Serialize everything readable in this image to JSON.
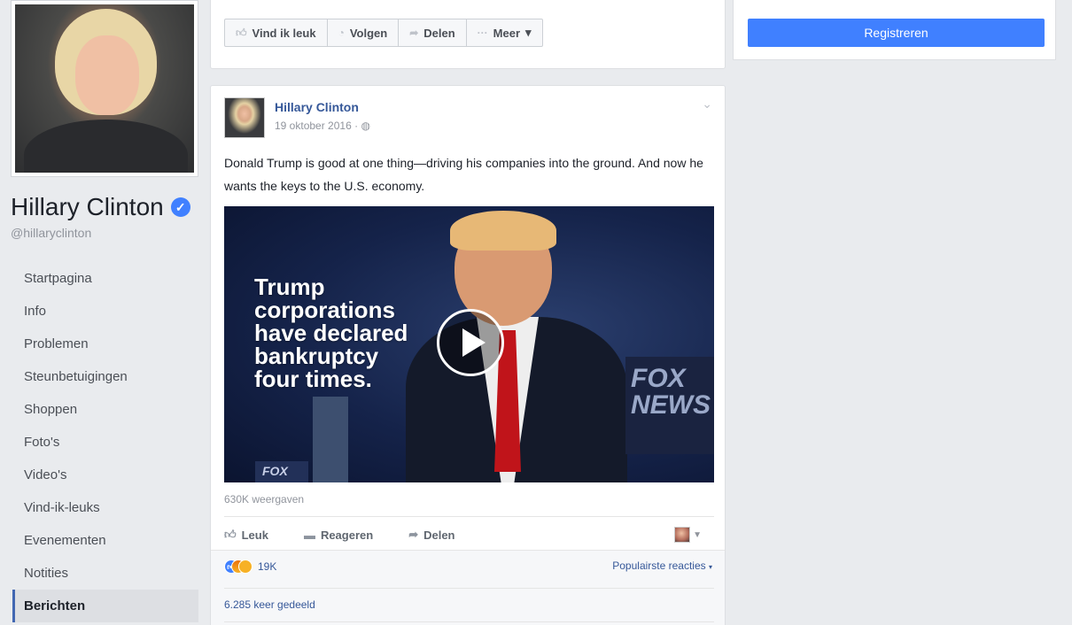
{
  "profile": {
    "name": "Hillary Clinton",
    "verified_mark": "✓",
    "username": "@hillaryclinton"
  },
  "side_nav": {
    "items": [
      {
        "label": "Startpagina"
      },
      {
        "label": "Info"
      },
      {
        "label": "Problemen"
      },
      {
        "label": "Steunbetuigingen"
      },
      {
        "label": "Shoppen"
      },
      {
        "label": "Foto's"
      },
      {
        "label": "Video's"
      },
      {
        "label": "Vind-ik-leuks"
      },
      {
        "label": "Evenementen"
      },
      {
        "label": "Notities"
      },
      {
        "label": "Berichten",
        "active": true
      }
    ]
  },
  "page_actions": {
    "like_label": "Vind ik leuk",
    "follow_label": "Volgen",
    "share_label": "Delen",
    "more_label": "Meer"
  },
  "register": {
    "label": "Registreren",
    "color": "#4080ff"
  },
  "post": {
    "author": "Hillary Clinton",
    "date": "19 oktober 2016",
    "text": "Donald Trump is good at one thing—driving his companies into the ground. And now he wants the keys to the U.S. economy.",
    "video_caption": "Trump\ncorporations\nhave declared\nbankruptcy\nfour times.",
    "video_network": "FOX\nNEWS",
    "video_network_small": "FOX",
    "views": "630K weergaven",
    "actions": {
      "like": "Leuk",
      "comment": "Reageren",
      "share": "Delen"
    },
    "reactions_count": "19K",
    "popular_label": "Populairste reacties",
    "shares": "6.285 keer gedeeld"
  },
  "colors": {
    "link": "#365899",
    "background": "#e9ebee",
    "accent": "#4267b2"
  }
}
